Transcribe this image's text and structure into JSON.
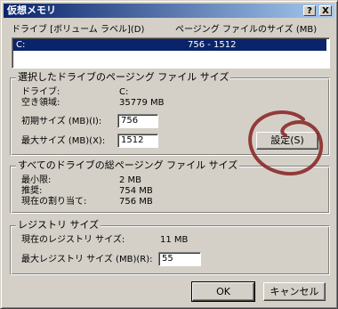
{
  "window": {
    "title": "仮想メモリ",
    "help_btn": "?",
    "close_btn": "X"
  },
  "drive_list": {
    "header_drive": "ドライブ  [ボリューム ラベル](D)",
    "header_size": "ページング ファイルのサイズ (MB)",
    "rows": [
      {
        "drive": "C:",
        "size": "756 - 1512"
      }
    ]
  },
  "selected_drive": {
    "title": "選択したドライブのページング ファイル サイズ",
    "drive_label": "ドライブ:",
    "drive_value": "C:",
    "free_label": "空き領域:",
    "free_value": "35779 MB",
    "initial_label": "初期サイズ (MB)(I):",
    "initial_value": "756",
    "max_label": "最大サイズ (MB)(X):",
    "max_value": "1512",
    "set_button": "設定(S)"
  },
  "all_drives": {
    "title": "すべてのドライブの総ページング ファイル サイズ",
    "min_label": "最小限:",
    "min_value": "2 MB",
    "rec_label": "推奨:",
    "rec_value": "754 MB",
    "cur_label": "現在の割り当て:",
    "cur_value": "756 MB"
  },
  "registry": {
    "title": "レジストリ サイズ",
    "current_label": "現在のレジストリ サイズ:",
    "current_value": "11 MB",
    "max_label": "最大レジストリ サイズ (MB)(R):",
    "max_value": "55"
  },
  "buttons": {
    "ok": "OK",
    "cancel": "キャンセル"
  },
  "colors": {
    "dialog_bg": "#d4d0c8",
    "title_start": "#0a246a",
    "title_end": "#a6caf0",
    "scribble": "#8b2a2a"
  }
}
